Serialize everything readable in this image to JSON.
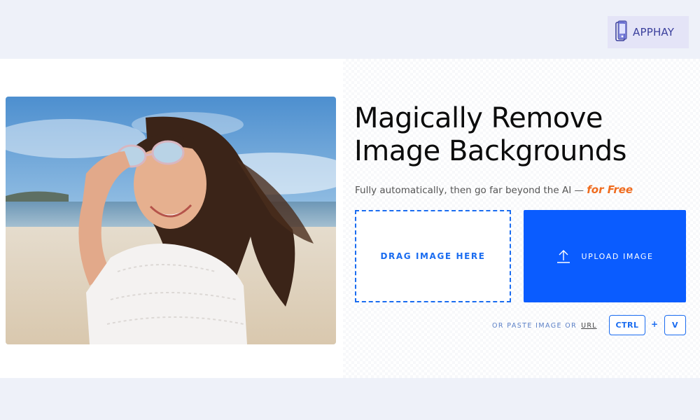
{
  "brand": {
    "name": "APPHAY"
  },
  "hero": {
    "headline_line1": "Magically Remove",
    "headline_line2": "Image Backgrounds",
    "subline": "Fully automatically, then go far beyond the AI — ",
    "subline_emphasis": "for Free"
  },
  "upload": {
    "drop_label": "DRAG IMAGE HERE",
    "button_label": "UPLOAD IMAGE",
    "paste_text": "OR PASTE IMAGE OR",
    "paste_url": "URL",
    "shortcut_ctrl": "CTRL",
    "shortcut_plus": "+",
    "shortcut_v": "V"
  },
  "icons": {
    "logo": "phone-logo-icon",
    "upload": "upload-arrow-icon"
  },
  "colors": {
    "accent": "#0a5cff",
    "accent_text": "#1a6cf0",
    "emphasis": "#ef6c1f",
    "page_bg": "#eef1f9"
  }
}
